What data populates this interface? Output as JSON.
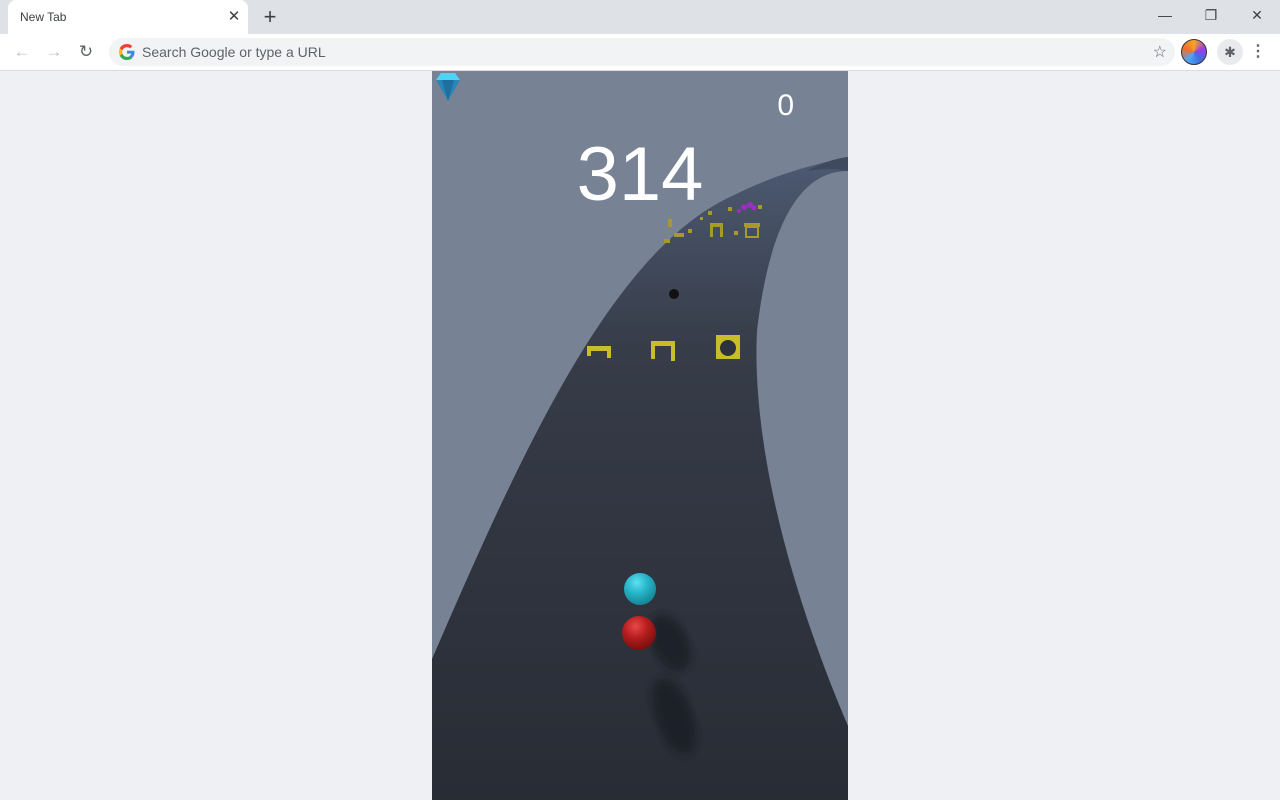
{
  "browser": {
    "tab_title": "New Tab",
    "tab_close": "✕",
    "new_tab": "+",
    "window_controls": {
      "minimize": "—",
      "restore": "❐",
      "close": "✕"
    },
    "nav": {
      "back": "←",
      "forward": "→",
      "reload": "↻"
    },
    "omnibox_placeholder": "Search Google or type a URL",
    "bookmark_icon": "☆",
    "extensions_icon": "✱",
    "menu_icon": "⋮"
  },
  "game": {
    "score": "314",
    "gem_count": "0",
    "colors": {
      "sky": "#788295",
      "track": "#2c3039",
      "ball_player": "#b01c1c",
      "ball_follower": "#2bb8cc",
      "obstacle": "#c9be2a",
      "gem": "#2a9fd8"
    }
  }
}
